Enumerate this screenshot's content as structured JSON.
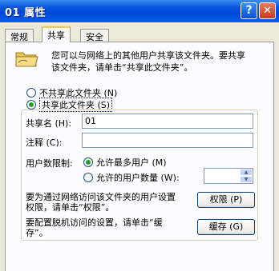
{
  "window": {
    "title": "01 属性",
    "help_glyph": "?",
    "close_glyph": "✕"
  },
  "tabs": [
    {
      "label": "常规"
    },
    {
      "label": "共享"
    },
    {
      "label": "安全"
    }
  ],
  "intro": {
    "lines": [
      "您可以与网络上的其他用户共享该文件夹。要共享",
      "该文件夹，请单击“共享此文件夹”。"
    ]
  },
  "share_options": {
    "not_shared_label": "不共享此文件夹 (N)",
    "shared_label": "共享此文件夹 (S)",
    "selected": "shared"
  },
  "share_name": {
    "label": "共享名 (H):",
    "value": "01"
  },
  "comment": {
    "label": "注释 (C):",
    "value": ""
  },
  "user_limit": {
    "label": "用户数限制:",
    "max_allowed_label": "允许最多用户 (M)",
    "allowed_users_label": "允许的用户数量 (W):",
    "selected": "max",
    "spin_value": ""
  },
  "permissions": {
    "lines": [
      "要为通过网络访问该文件夹的用户设置",
      "权限，请单击“权限”。"
    ],
    "button_label": "权限 (P)"
  },
  "caching": {
    "lines": [
      "要配置脱机访问的设置，请单击“缓",
      "存”。"
    ],
    "button_label": "缓存 (G)"
  },
  "colors": {
    "titlebar": "#0a58e0",
    "active_tab_accent": "#ffc83c",
    "radio_checked": "#21a121"
  },
  "icons": {
    "folder": "shared-folder-icon"
  }
}
